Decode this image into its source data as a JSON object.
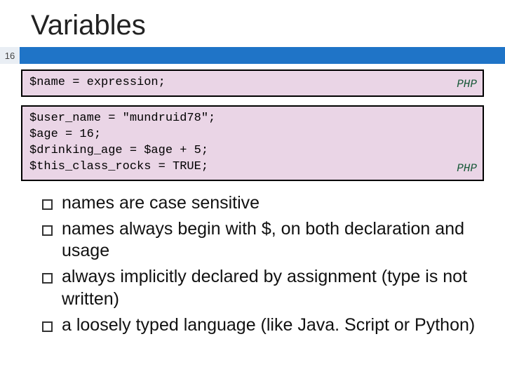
{
  "title": "Variables",
  "page_number": "16",
  "code1": {
    "line1": "$name = expression;",
    "lang": "PHP"
  },
  "code2": {
    "line1": "$user_name = \"mundruid78\";",
    "line2": "$age = 16;",
    "line3": "$drinking_age = $age + 5;",
    "line4": "$this_class_rocks = TRUE;",
    "lang": "PHP"
  },
  "bullets": {
    "b1": "names are case sensitive",
    "b2": "names always begin with $, on both declaration and usage",
    "b3": "always implicitly declared by assignment (type is not written)",
    "b4": "a loosely typed language (like Java. Script or Python)"
  }
}
